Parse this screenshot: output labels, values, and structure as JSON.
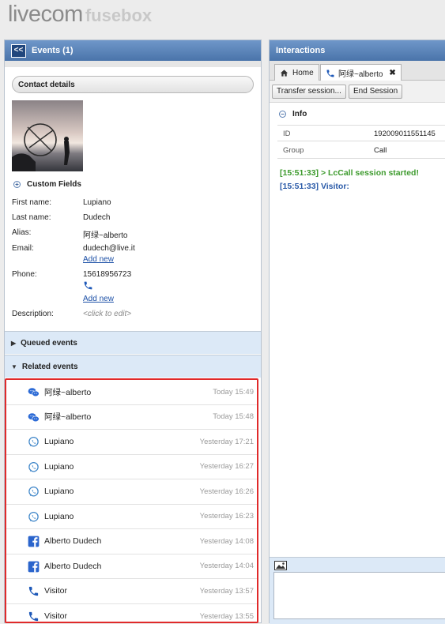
{
  "logo": {
    "part1": "livecom",
    "part2": "fusebox"
  },
  "left_panel": {
    "back_label": "<<",
    "title": "Events (1)",
    "contact_details_label": "Contact details",
    "custom_fields_label": "Custom Fields",
    "fields": {
      "first_name": {
        "label": "First name:",
        "value": "Lupiano"
      },
      "last_name": {
        "label": "Last name:",
        "value": "Dudech"
      },
      "alias": {
        "label": "Alias:",
        "value": "阿绿~alberto"
      },
      "email": {
        "label": "Email:",
        "value": "dudech@live.it",
        "add": "Add new"
      },
      "phone": {
        "label": "Phone:",
        "value": "15618956723",
        "add": "Add new"
      },
      "description": {
        "label": "Description:",
        "value": "<click to edit>"
      }
    },
    "queued_events_label": "Queued events",
    "related_events_label": "Related events",
    "related_events": [
      {
        "icon": "wechat-icon",
        "name": "阿绿~alberto",
        "time": "Today 15:49"
      },
      {
        "icon": "wechat-icon",
        "name": "阿绿~alberto",
        "time": "Today 15:48"
      },
      {
        "icon": "whatsapp-icon",
        "name": "Lupiano",
        "time": "Yesterday 17:21"
      },
      {
        "icon": "whatsapp-icon",
        "name": "Lupiano",
        "time": "Yesterday 16:27"
      },
      {
        "icon": "whatsapp-icon",
        "name": "Lupiano",
        "time": "Yesterday 16:26"
      },
      {
        "icon": "whatsapp-icon",
        "name": "Lupiano",
        "time": "Yesterday 16:23"
      },
      {
        "icon": "facebook-icon",
        "name": "Alberto Dudech",
        "time": "Yesterday 14:08"
      },
      {
        "icon": "facebook-icon",
        "name": "Alberto Dudech",
        "time": "Yesterday 14:04"
      },
      {
        "icon": "phone-icon",
        "name": "Visitor",
        "time": "Yesterday 13:57"
      },
      {
        "icon": "phone-icon",
        "name": "Visitor",
        "time": "Yesterday 13:55"
      }
    ]
  },
  "right_panel": {
    "title": "Interactions",
    "tabs": [
      {
        "label": "Home",
        "icon": "home-icon"
      },
      {
        "label": "阿绿~alberto",
        "icon": "phone-icon",
        "close": "✖"
      }
    ],
    "buttons": {
      "transfer": "Transfer session...",
      "end": "End Session"
    },
    "info_label": "Info",
    "info_rows": [
      {
        "key": "ID",
        "value": "192009011551145"
      },
      {
        "key": "Group",
        "value": "Call"
      }
    ],
    "log": [
      "[15:51:33] > LcCall session started!",
      "[15:51:33] Visitor:"
    ]
  },
  "colors": {
    "header_blue": "#4a74aa",
    "section_blue": "#dce9f7",
    "highlight_red": "#e02a2a",
    "log_green": "#3c9a2c",
    "log_blue": "#2a5aa8",
    "wechat": "#2d6bd6",
    "whatsapp": "#3f86c9",
    "facebook": "#2a64cc"
  }
}
